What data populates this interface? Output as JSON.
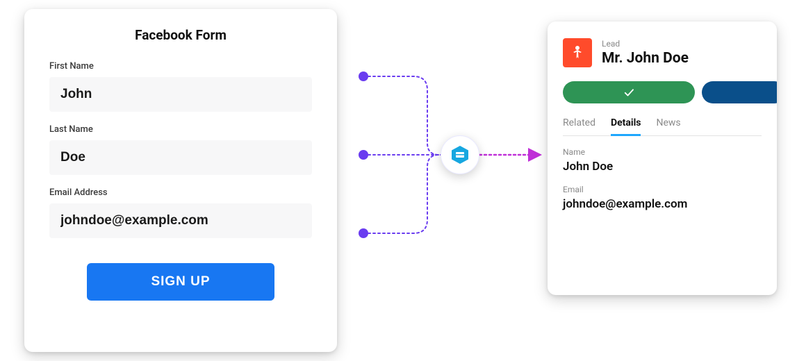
{
  "form": {
    "title": "Facebook Form",
    "fields": {
      "first_name_label": "First Name",
      "first_name_value": "John",
      "last_name_label": "Last Name",
      "last_name_value": "Doe",
      "email_label": "Email Address",
      "email_value": "johndoe@example.com"
    },
    "submit_label": "SIGN UP"
  },
  "lead": {
    "type_label": "Lead",
    "full_name": "Mr. John Doe",
    "tabs": {
      "related": "Related",
      "details": "Details",
      "news": "News"
    },
    "detail_name_label": "Name",
    "detail_name_value": "John Doe",
    "detail_email_label": "Email",
    "detail_email_value": "johndoe@example.com"
  },
  "colors": {
    "primary_blue": "#1877f2",
    "accent_green": "#2e9455",
    "accent_darkblue": "#0a4f8a",
    "lead_icon_bg": "#ff4b2b",
    "connector_purple": "#6a3cf0",
    "arrow_magenta": "#c030d8"
  }
}
